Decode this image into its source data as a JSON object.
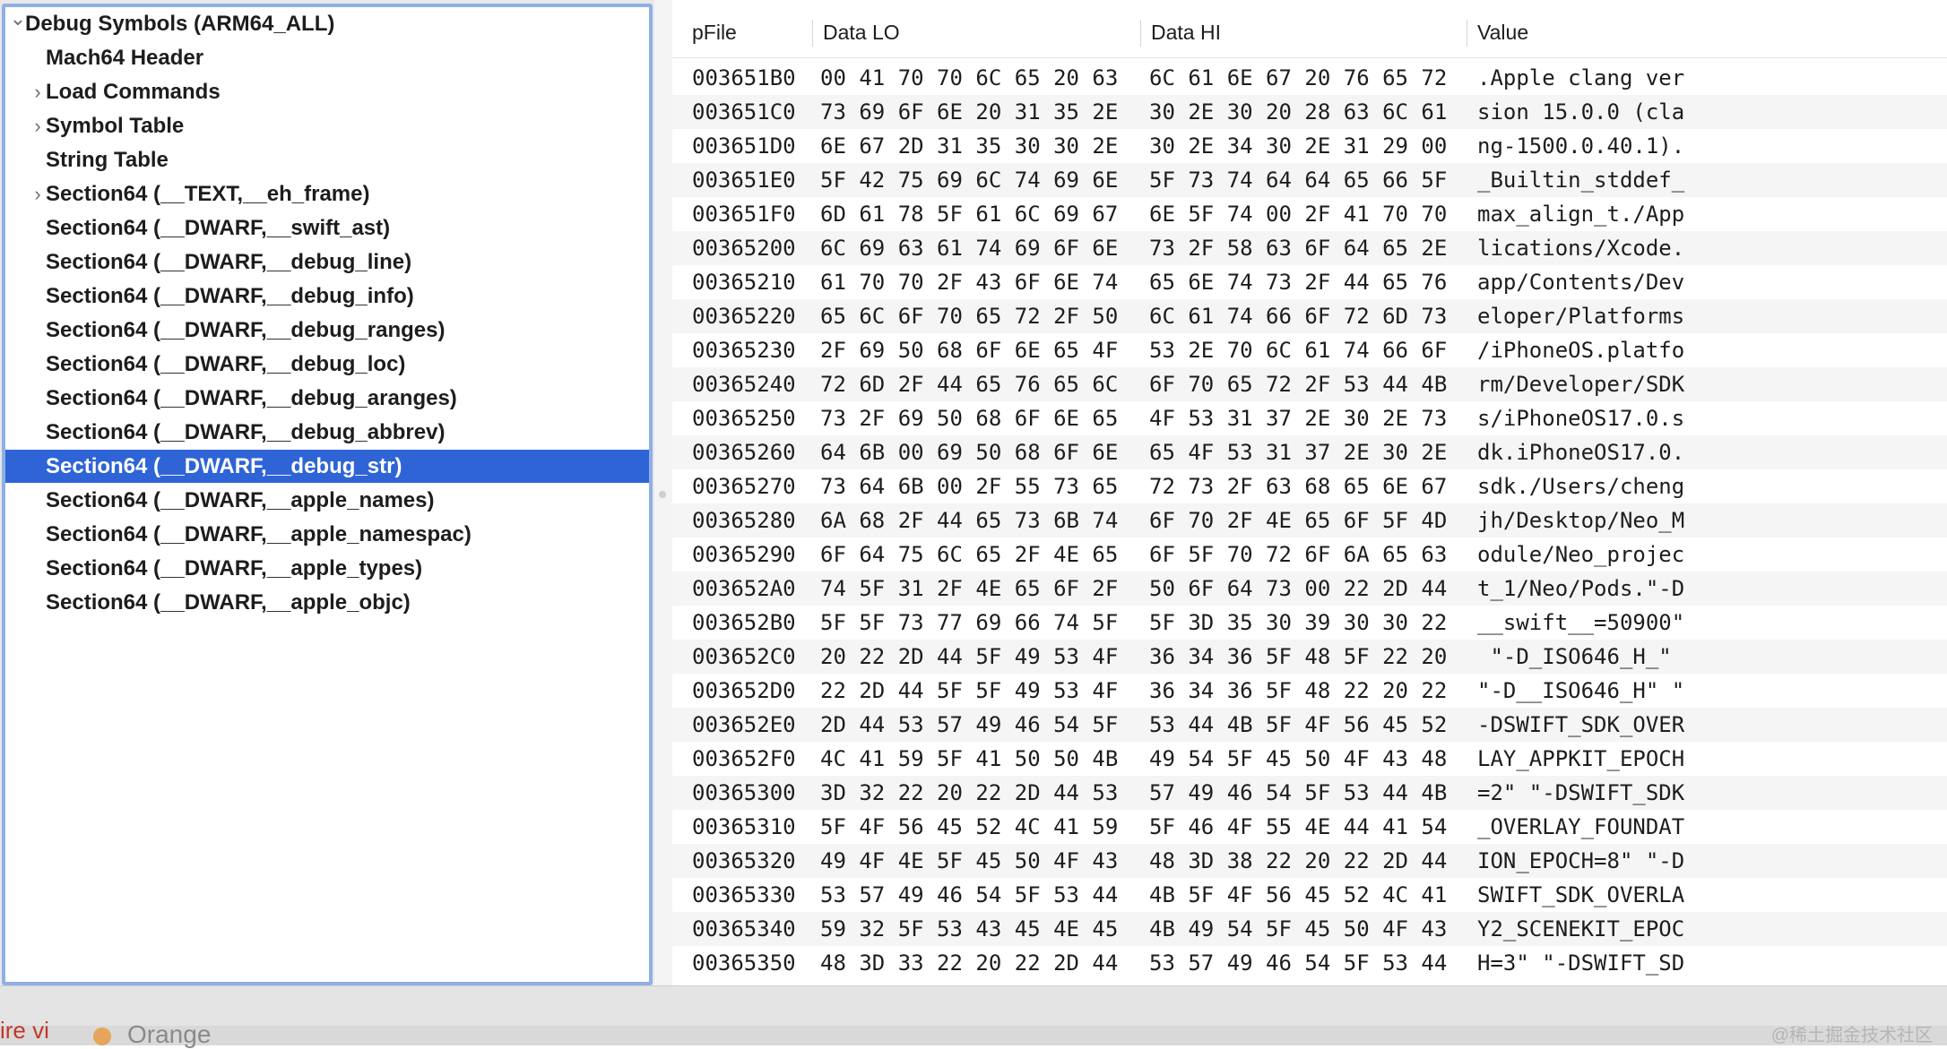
{
  "outline": {
    "items": [
      {
        "label": "Debug Symbols (ARM64_ALL)",
        "chevron": "down",
        "level": 0,
        "selected": false
      },
      {
        "label": "Mach64 Header",
        "chevron": "",
        "level": 1,
        "selected": false
      },
      {
        "label": "Load Commands",
        "chevron": "right",
        "level": 1,
        "selected": false
      },
      {
        "label": "Symbol Table",
        "chevron": "right",
        "level": 1,
        "selected": false
      },
      {
        "label": "String Table",
        "chevron": "",
        "level": 1,
        "selected": false
      },
      {
        "label": "Section64 (__TEXT,__eh_frame)",
        "chevron": "right",
        "level": 1,
        "selected": false
      },
      {
        "label": "Section64 (__DWARF,__swift_ast)",
        "chevron": "",
        "level": 1,
        "selected": false
      },
      {
        "label": "Section64 (__DWARF,__debug_line)",
        "chevron": "",
        "level": 1,
        "selected": false
      },
      {
        "label": "Section64 (__DWARF,__debug_info)",
        "chevron": "",
        "level": 1,
        "selected": false
      },
      {
        "label": "Section64 (__DWARF,__debug_ranges)",
        "chevron": "",
        "level": 1,
        "selected": false
      },
      {
        "label": "Section64 (__DWARF,__debug_loc)",
        "chevron": "",
        "level": 1,
        "selected": false
      },
      {
        "label": "Section64 (__DWARF,__debug_aranges)",
        "chevron": "",
        "level": 1,
        "selected": false
      },
      {
        "label": "Section64 (__DWARF,__debug_abbrev)",
        "chevron": "",
        "level": 1,
        "selected": false
      },
      {
        "label": "Section64 (__DWARF,__debug_str)",
        "chevron": "",
        "level": 1,
        "selected": true
      },
      {
        "label": "Section64 (__DWARF,__apple_names)",
        "chevron": "",
        "level": 1,
        "selected": false
      },
      {
        "label": "Section64 (__DWARF,__apple_namespac)",
        "chevron": "",
        "level": 1,
        "selected": false
      },
      {
        "label": "Section64 (__DWARF,__apple_types)",
        "chevron": "",
        "level": 1,
        "selected": false
      },
      {
        "label": "Section64 (__DWARF,__apple_objc)",
        "chevron": "",
        "level": 1,
        "selected": false
      }
    ]
  },
  "table": {
    "columns": [
      "pFile",
      "Data LO",
      "Data HI",
      "Value"
    ],
    "rows": [
      [
        "003651B0",
        "00 41 70 70 6C 65 20 63",
        "6C 61 6E 67 20 76 65 72",
        ".Apple clang ver"
      ],
      [
        "003651C0",
        "73 69 6F 6E 20 31 35 2E",
        "30 2E 30 20 28 63 6C 61",
        "sion 15.0.0 (cla"
      ],
      [
        "003651D0",
        "6E 67 2D 31 35 30 30 2E",
        "30 2E 34 30 2E 31 29 00",
        "ng-1500.0.40.1)."
      ],
      [
        "003651E0",
        "5F 42 75 69 6C 74 69 6E",
        "5F 73 74 64 64 65 66 5F",
        "_Builtin_stddef_"
      ],
      [
        "003651F0",
        "6D 61 78 5F 61 6C 69 67",
        "6E 5F 74 00 2F 41 70 70",
        "max_align_t./App"
      ],
      [
        "00365200",
        "6C 69 63 61 74 69 6F 6E",
        "73 2F 58 63 6F 64 65 2E",
        "lications/Xcode."
      ],
      [
        "00365210",
        "61 70 70 2F 43 6F 6E 74",
        "65 6E 74 73 2F 44 65 76",
        "app/Contents/Dev"
      ],
      [
        "00365220",
        "65 6C 6F 70 65 72 2F 50",
        "6C 61 74 66 6F 72 6D 73",
        "eloper/Platforms"
      ],
      [
        "00365230",
        "2F 69 50 68 6F 6E 65 4F",
        "53 2E 70 6C 61 74 66 6F",
        "/iPhoneOS.platfo"
      ],
      [
        "00365240",
        "72 6D 2F 44 65 76 65 6C",
        "6F 70 65 72 2F 53 44 4B",
        "rm/Developer/SDK"
      ],
      [
        "00365250",
        "73 2F 69 50 68 6F 6E 65",
        "4F 53 31 37 2E 30 2E 73",
        "s/iPhoneOS17.0.s"
      ],
      [
        "00365260",
        "64 6B 00 69 50 68 6F 6E",
        "65 4F 53 31 37 2E 30 2E",
        "dk.iPhoneOS17.0."
      ],
      [
        "00365270",
        "73 64 6B 00 2F 55 73 65",
        "72 73 2F 63 68 65 6E 67",
        "sdk./Users/cheng"
      ],
      [
        "00365280",
        "6A 68 2F 44 65 73 6B 74",
        "6F 70 2F 4E 65 6F 5F 4D",
        "jh/Desktop/Neo_M"
      ],
      [
        "00365290",
        "6F 64 75 6C 65 2F 4E 65",
        "6F 5F 70 72 6F 6A 65 63",
        "odule/Neo_projec"
      ],
      [
        "003652A0",
        "74 5F 31 2F 4E 65 6F 2F",
        "50 6F 64 73 00 22 2D 44",
        "t_1/Neo/Pods.\"-D"
      ],
      [
        "003652B0",
        "5F 5F 73 77 69 66 74 5F",
        "5F 3D 35 30 39 30 30 22",
        "__swift__=50900\""
      ],
      [
        "003652C0",
        "20 22 2D 44 5F 49 53 4F",
        "36 34 36 5F 48 5F 22 20",
        " \"-D_ISO646_H_\" "
      ],
      [
        "003652D0",
        "22 2D 44 5F 5F 49 53 4F",
        "36 34 36 5F 48 22 20 22",
        "\"-D__ISO646_H\" \""
      ],
      [
        "003652E0",
        "2D 44 53 57 49 46 54 5F",
        "53 44 4B 5F 4F 56 45 52",
        "-DSWIFT_SDK_OVER"
      ],
      [
        "003652F0",
        "4C 41 59 5F 41 50 50 4B",
        "49 54 5F 45 50 4F 43 48",
        "LAY_APPKIT_EPOCH"
      ],
      [
        "00365300",
        "3D 32 22 20 22 2D 44 53",
        "57 49 46 54 5F 53 44 4B",
        "=2\" \"-DSWIFT_SDK"
      ],
      [
        "00365310",
        "5F 4F 56 45 52 4C 41 59",
        "5F 46 4F 55 4E 44 41 54",
        "_OVERLAY_FOUNDAT"
      ],
      [
        "00365320",
        "49 4F 4E 5F 45 50 4F 43",
        "48 3D 38 22 20 22 2D 44",
        "ION_EPOCH=8\" \"-D"
      ],
      [
        "00365330",
        "53 57 49 46 54 5F 53 44",
        "4B 5F 4F 56 45 52 4C 41",
        "SWIFT_SDK_OVERLA"
      ],
      [
        "00365340",
        "59 32 5F 53 43 45 4E 45",
        "4B 49 54 5F 45 50 4F 43",
        "Y2_SCENEKIT_EPOC"
      ],
      [
        "00365350",
        "48 3D 33 22 20 22 2D 44",
        "53 57 49 46 54 5F 53 44",
        "H=3\" \"-DSWIFT_SD"
      ]
    ]
  },
  "bottom": {
    "left_text": "ire vi",
    "orange_label": "Orange",
    "watermark": "@稀土掘金技术社区"
  }
}
